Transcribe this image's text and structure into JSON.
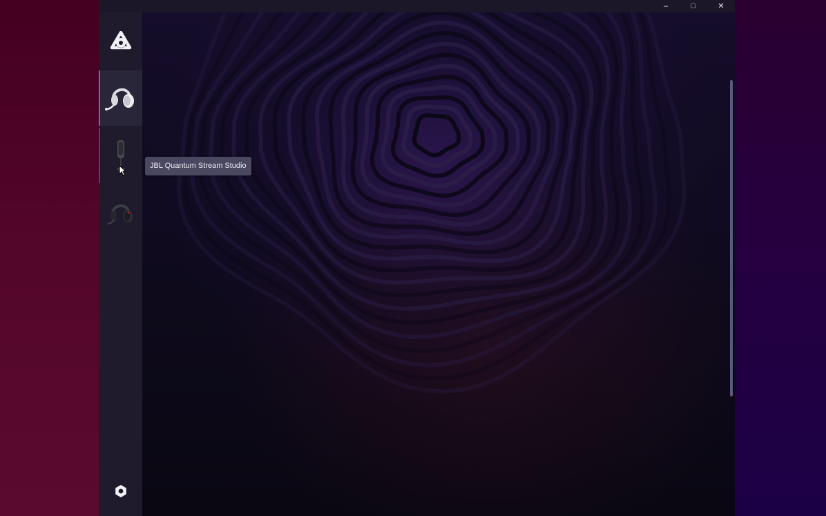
{
  "window": {
    "minimize_label": "–",
    "maximize_label": "□",
    "close_label": "✕"
  },
  "sidebar": {
    "logo_icon": "jbl-quantum-engine-logo-icon",
    "devices": [
      {
        "icon": "white-gaming-headset-icon",
        "selected": true
      },
      {
        "icon": "microphone-icon",
        "name": "JBL Quantum Stream Studio",
        "selected": false
      },
      {
        "icon": "black-gaming-headset-icon",
        "selected": false
      }
    ],
    "settings_icon": "settings-gear-icon"
  },
  "tooltip": {
    "text": "JBL Quantum Stream Studio"
  },
  "colors": {
    "accent": "#7d5ce0",
    "sidebar_bg": "#1f1b2c",
    "tooltip_bg": "#4a4761"
  }
}
